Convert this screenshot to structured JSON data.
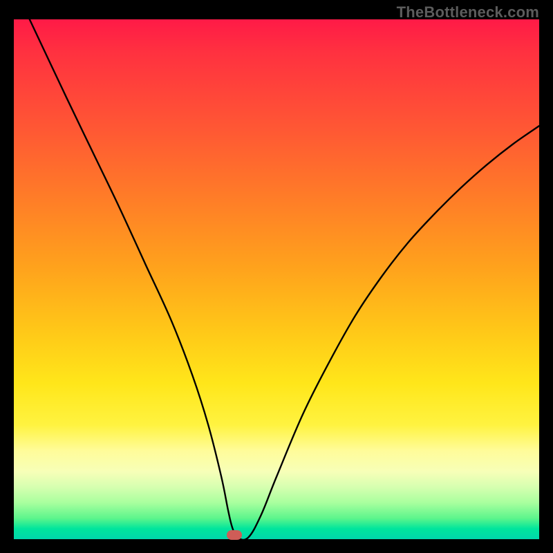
{
  "watermark": "TheBottleneck.com",
  "chart_data": {
    "type": "line",
    "title": "",
    "xlabel": "",
    "ylabel": "",
    "xlim": [
      0,
      100
    ],
    "ylim": [
      0,
      100
    ],
    "colors": {
      "gradient_top": "#ff1a47",
      "gradient_mid": "#ffe61a",
      "gradient_bottom": "#00d7ab",
      "curve": "#000000",
      "marker": "#cf5d57",
      "frame": "#000000"
    },
    "series": [
      {
        "name": "bottleneck-curve",
        "x": [
          3,
          10,
          15,
          20,
          25,
          30,
          34,
          37,
          39.5,
          40.8,
          41.6,
          42.6,
          44.6,
          47,
          50,
          55,
          60,
          65,
          70,
          75,
          80,
          85,
          90,
          95,
          100
        ],
        "values": [
          100,
          85,
          74.5,
          64,
          53,
          42,
          31.5,
          22,
          12,
          5.5,
          2.2,
          0.3,
          0.3,
          4.5,
          12,
          24,
          34,
          43,
          50.5,
          57,
          62.5,
          67.5,
          72,
          76,
          79.5
        ]
      }
    ],
    "marker": {
      "x": 42,
      "y": 0
    },
    "annotations": []
  }
}
